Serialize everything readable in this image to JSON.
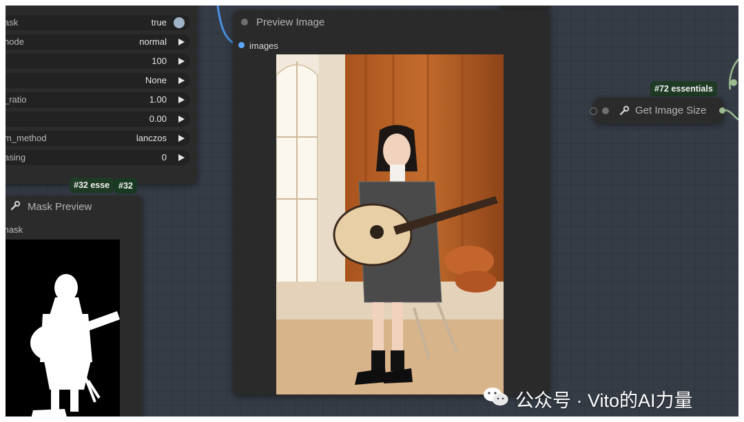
{
  "settings_node": {
    "rows": [
      {
        "label": "ask",
        "value": "true",
        "control": "toggle"
      },
      {
        "label": "node",
        "value": "normal",
        "control": "arrow"
      },
      {
        "label": "",
        "value": "100",
        "control": "arrow"
      },
      {
        "label": "",
        "value": "None",
        "control": "arrow"
      },
      {
        "label": "_ratio",
        "value": "1.00",
        "control": "arrow"
      },
      {
        "label": "",
        "value": "0.00",
        "control": "arrow"
      },
      {
        "label": "m_method",
        "value": "lanczos",
        "control": "arrow"
      },
      {
        "label": "asing",
        "value": "0",
        "control": "arrow"
      }
    ]
  },
  "badges": {
    "left_a": "#32 esse",
    "left_b": "#32",
    "right": "#72 essentials"
  },
  "mask_node": {
    "title": "Mask Preview",
    "slot": "mask",
    "icon": "wrench-icon"
  },
  "preview_node": {
    "title": "Preview Image",
    "slot": "images"
  },
  "size_node": {
    "title": "Get Image Size",
    "icon": "wrench-icon"
  },
  "watermark": {
    "text": "公众号 · Vito的AI力量",
    "icon": "wechat-icon"
  },
  "colors": {
    "canvas": "#353c46",
    "node": "#2b2b2b",
    "widget": "#222222",
    "badge": "#1f3a25",
    "link_blue": "#4a90e2",
    "link_green": "#9bbb91",
    "slot_blue": "#5aa8ff"
  }
}
